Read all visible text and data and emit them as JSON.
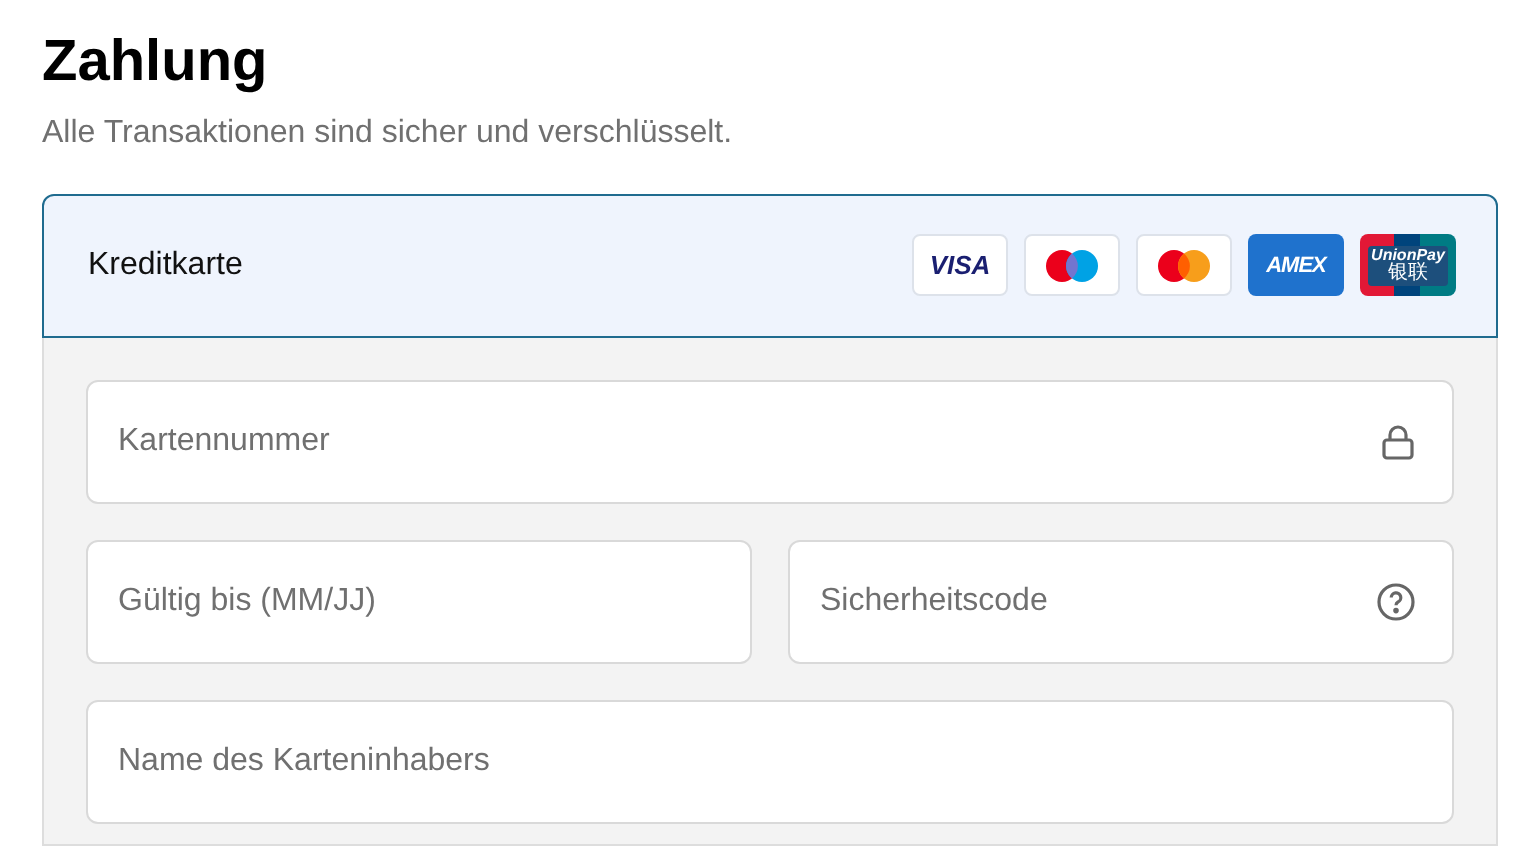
{
  "heading": "Zahlung",
  "subtitle": "Alle Transaktionen sind sicher und verschlüsselt.",
  "payment_method": {
    "label": "Kreditkarte",
    "selected": true,
    "card_logos": [
      {
        "kind": "visa",
        "texts": [
          "VISA"
        ]
      },
      {
        "kind": "maestro"
      },
      {
        "kind": "mastercard"
      },
      {
        "kind": "amex",
        "texts": [
          "AMEX"
        ]
      },
      {
        "kind": "unionpay",
        "texts": [
          "UnionPay",
          "银联"
        ]
      }
    ]
  },
  "fields": [
    {
      "kind": "card_number",
      "placeholder": "Kartennummer"
    },
    {
      "kind": "expiry",
      "placeholder": "Gültig bis (MM/JJ)"
    },
    {
      "kind": "security_code",
      "placeholder": "Sicherheitscode"
    },
    {
      "kind": "name",
      "placeholder": "Name des Karteninhabers"
    }
  ]
}
